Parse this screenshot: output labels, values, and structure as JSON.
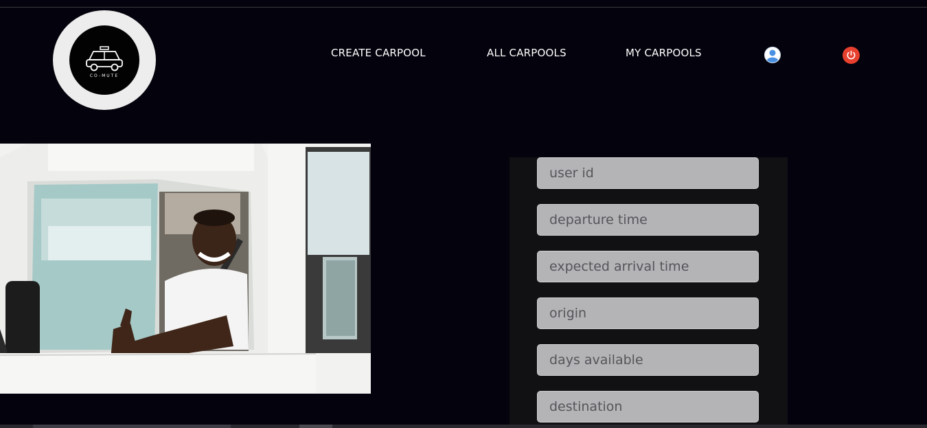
{
  "logo": {
    "text": "CO-MUTE"
  },
  "nav": {
    "create_carpool": "CREATE CARPOOL",
    "all_carpools": "ALL CARPOOLS",
    "my_carpools": "MY CARPOOLS"
  },
  "icons": {
    "user": "user-icon",
    "power": "power-icon",
    "power_color": "#e8402f",
    "user_color": "#4a90e2"
  },
  "form": {
    "user_id": {
      "placeholder": "user id",
      "value": ""
    },
    "departure_time": {
      "placeholder": "departure time",
      "value": ""
    },
    "expected_arrival_time": {
      "placeholder": "expected arrival time",
      "value": ""
    },
    "origin": {
      "placeholder": "origin",
      "value": ""
    },
    "days_available": {
      "placeholder": "days available",
      "value": ""
    },
    "destination": {
      "placeholder": "destination",
      "value": ""
    }
  }
}
